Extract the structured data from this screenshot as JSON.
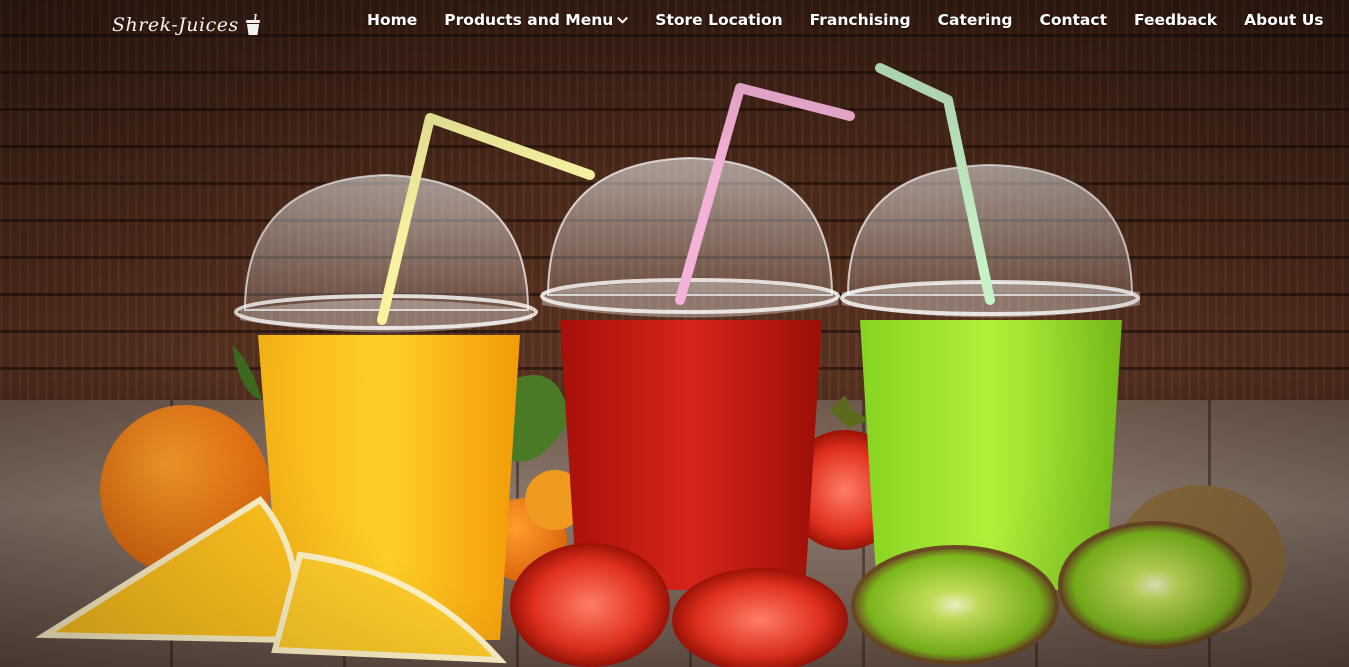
{
  "brand": {
    "logo_text": "Shrek-Juices",
    "logo_icon": "juice-cup-icon"
  },
  "nav": {
    "items": [
      {
        "label": "Home"
      },
      {
        "label": "Products and Menu",
        "icon": "chevron-down-icon"
      },
      {
        "label": "Store Location"
      },
      {
        "label": "Franchising"
      },
      {
        "label": "Catering"
      },
      {
        "label": "Contact"
      },
      {
        "label": "Feedback"
      },
      {
        "label": "About Us"
      }
    ]
  },
  "hero": {
    "image": "juice-cups-with-fruit",
    "colors": {
      "orange_juice": "#f5a50f",
      "tomato_juice": "#c0160c",
      "kiwi_juice": "#8fdc26",
      "wood_dark": "#3a1f14"
    }
  }
}
